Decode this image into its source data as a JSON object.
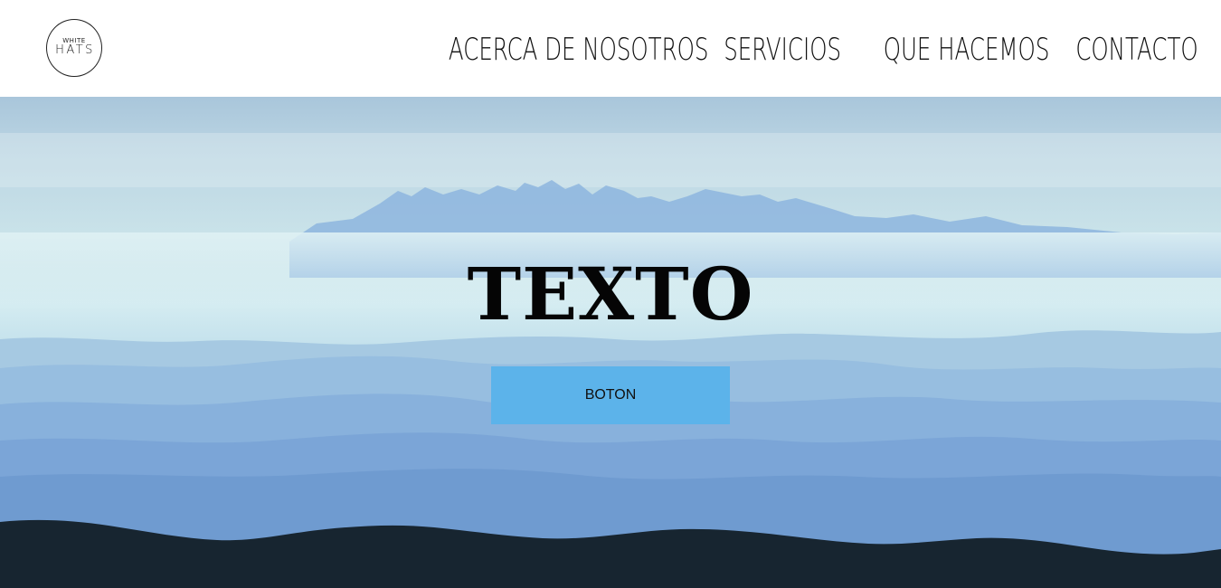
{
  "logo": {
    "top_text": "WHITE",
    "main_text": "HATS"
  },
  "nav": {
    "items": [
      {
        "label": "ACERCA DE NOSOTROS"
      },
      {
        "label": "SERVICIOS"
      },
      {
        "label": "QUE HACEMOS"
      },
      {
        "label": "CONTACTO"
      }
    ]
  },
  "hero": {
    "title": "TEXTO",
    "button_label": "BOTON",
    "background_image": "misty-blue-mountains-landscape",
    "button_color": "#5cb3ea"
  }
}
